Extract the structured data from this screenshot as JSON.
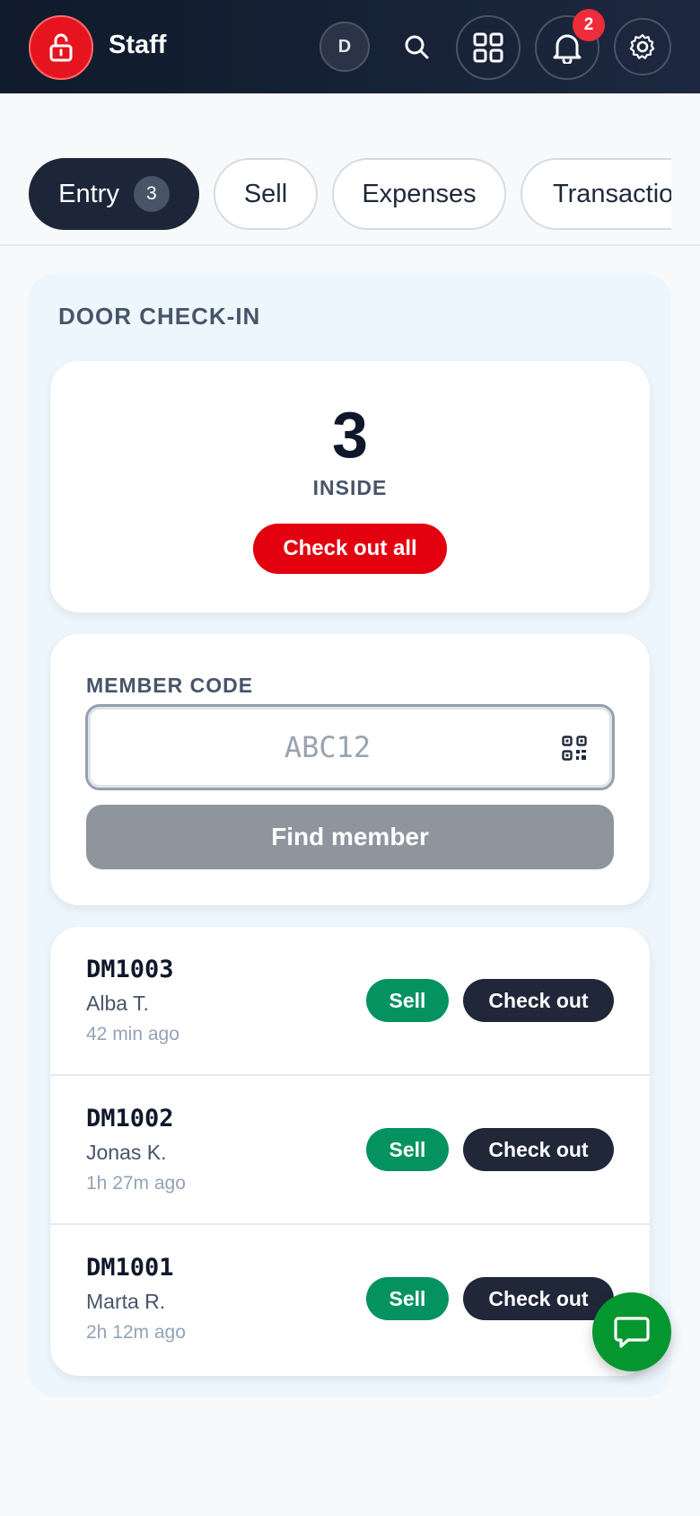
{
  "header": {
    "title": "Staff",
    "avatar_initial": "D",
    "notifications_count": "2"
  },
  "tabs": [
    {
      "label": "Entry",
      "count": "3",
      "active": true
    },
    {
      "label": "Sell",
      "active": false
    },
    {
      "label": "Expenses",
      "active": false
    },
    {
      "label": "Transactions",
      "active": false
    }
  ],
  "door_checkin": {
    "title": "DOOR CHECK-IN",
    "inside_count": "3",
    "inside_label": "INSIDE",
    "checkout_all_label": "Check out all"
  },
  "member_code": {
    "label": "MEMBER CODE",
    "placeholder": "ABC12",
    "value": "",
    "find_label": "Find member"
  },
  "members": [
    {
      "code": "DM1003",
      "name": "Alba T.",
      "time": "42 min ago",
      "sell_label": "Sell",
      "checkout_label": "Check out"
    },
    {
      "code": "DM1002",
      "name": "Jonas K.",
      "time": "1h 27m ago",
      "sell_label": "Sell",
      "checkout_label": "Check out"
    },
    {
      "code": "DM1001",
      "name": "Marta R.",
      "time": "2h 12m ago",
      "sell_label": "Sell",
      "checkout_label": "Check out"
    }
  ],
  "icons": {
    "brand": "lock-icon",
    "search": "search-icon",
    "apps": "grid-icon",
    "notifications": "bell-icon",
    "settings": "gear-icon",
    "qr": "qr-code-icon",
    "chat": "chat-icon"
  },
  "colors": {
    "header_bg": "#0f1a2b",
    "brand_red": "#e5141e",
    "danger": "#e3000f",
    "sell_green": "#059261",
    "dark_button": "#1f2739",
    "chat_green": "#04962f",
    "panel_bg": "#eef6fd"
  }
}
